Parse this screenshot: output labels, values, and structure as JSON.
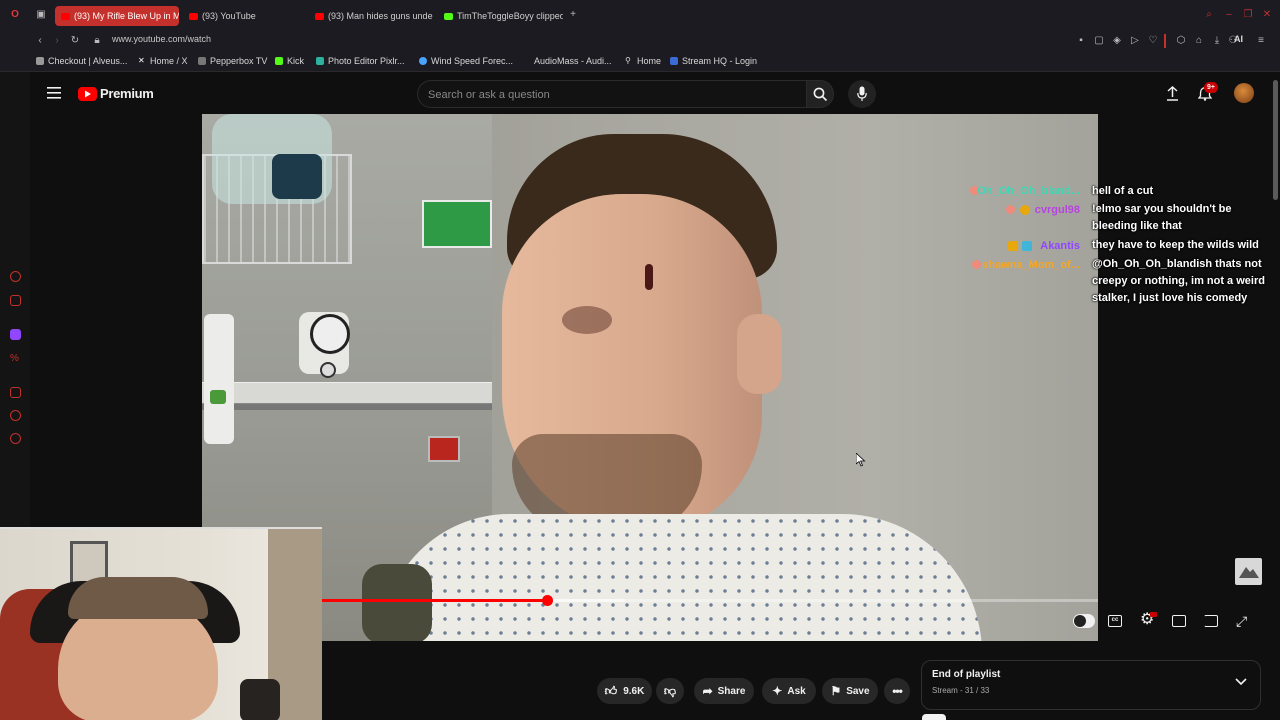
{
  "browser": {
    "tabs": [
      {
        "label": "(93) My Rifle Blew Up in M",
        "active": true
      },
      {
        "label": "(93) YouTube",
        "active": false
      },
      {
        "label": "(93) Man hides guns unde",
        "active": false
      },
      {
        "label": "TimTheToggleBoyy clipped",
        "active": false
      }
    ],
    "address": "www.youtube.com/watch",
    "bookmarks": [
      {
        "label": "Checkout | Alveus..."
      },
      {
        "label": "Home / X"
      },
      {
        "label": "Pepperbox TV"
      },
      {
        "label": "Kick"
      },
      {
        "label": "Photo Editor Pixlr..."
      },
      {
        "label": "Wind Speed Forec..."
      },
      {
        "label": "AudioMass - Audi..."
      },
      {
        "label": "Home"
      },
      {
        "label": "Stream HQ - Login"
      }
    ],
    "ai_label": "AI"
  },
  "youtube": {
    "logo_text": "Premium",
    "search_placeholder": "Search or ask a question",
    "notification_count": "9+",
    "accent": "#ff0000"
  },
  "video": {
    "progress_fraction": 0.29,
    "buffer_fraction": 0.39
  },
  "chat": [
    {
      "name": "Oh_Oh_Oh_bland...",
      "name_color": "#3fd7b4",
      "message": "hell of a cut"
    },
    {
      "name": "cvrgul98",
      "name_color": "#b844e0",
      "message": "!elmo sar you shouldn't be bleeding like that"
    },
    {
      "name": "Akantis",
      "name_color": "#9147ff",
      "message": "they have to keep the wilds wild"
    },
    {
      "name": "shawna_Mom_of...",
      "name_color": "#f5a623",
      "message": "@Oh_Oh_Oh_blandish thats not creepy or nothing, im not a weird stalker, I just love his comedy"
    }
  ],
  "actions": {
    "like_count": "9.6K",
    "share_label": "Share",
    "ask_label": "Ask",
    "save_label": "Save"
  },
  "playlist": {
    "title": "End of playlist",
    "subtitle": "Stream - 31 / 33"
  }
}
